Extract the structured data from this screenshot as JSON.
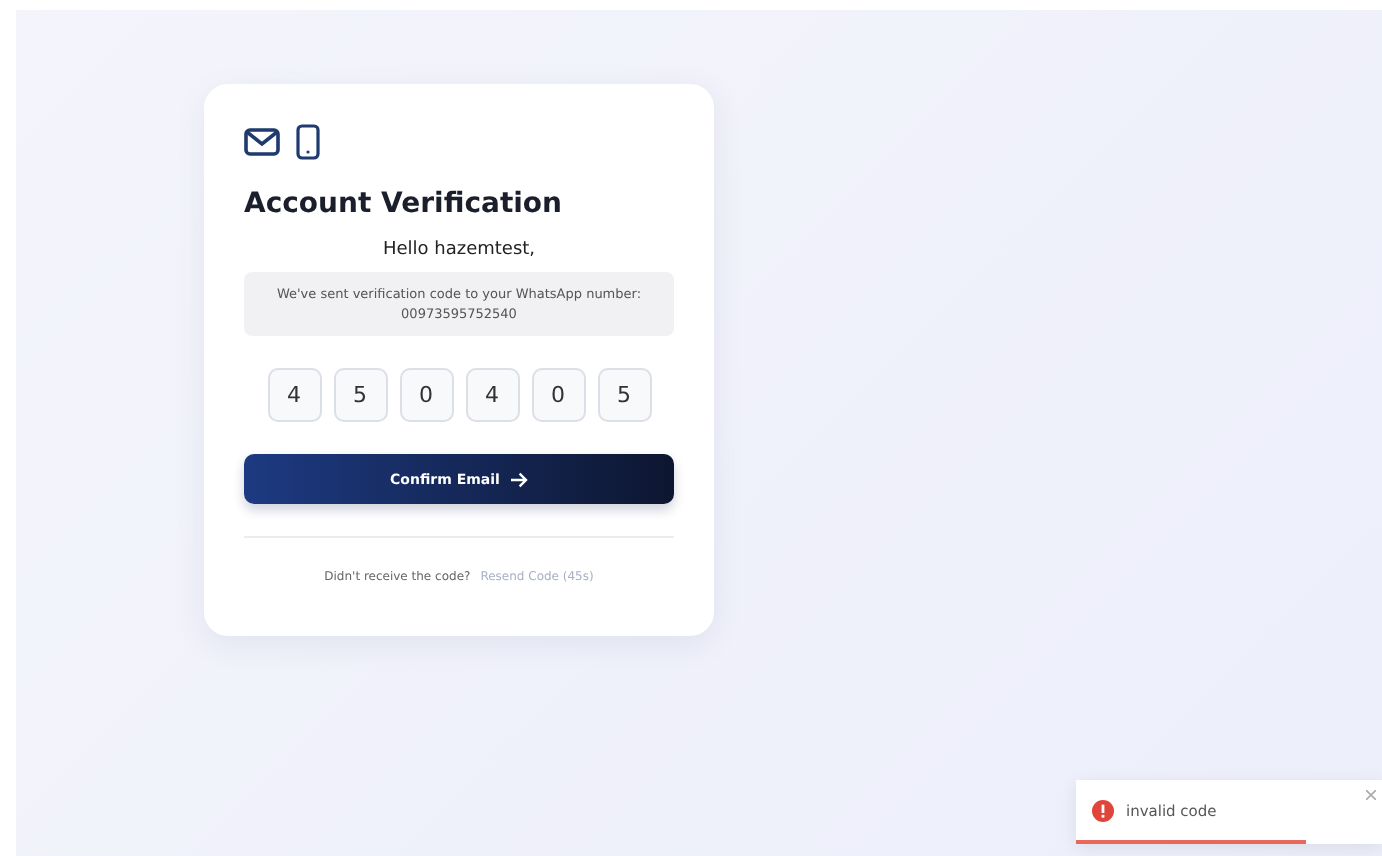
{
  "card": {
    "title": "Account Verification",
    "greeting": "Hello hazemtest,",
    "message": "We've sent verification code to your WhatsApp number:",
    "phone": "00973595752540",
    "code_digits": [
      "4",
      "5",
      "0",
      "4",
      "0",
      "5"
    ],
    "button": "Confirm Email",
    "footer": {
      "question": "Didn't receive the code?",
      "resend": "Resend Code (45s)",
      "resend_disabled": true
    }
  },
  "toast": {
    "message": "invalid code",
    "level": 0.75
  }
}
